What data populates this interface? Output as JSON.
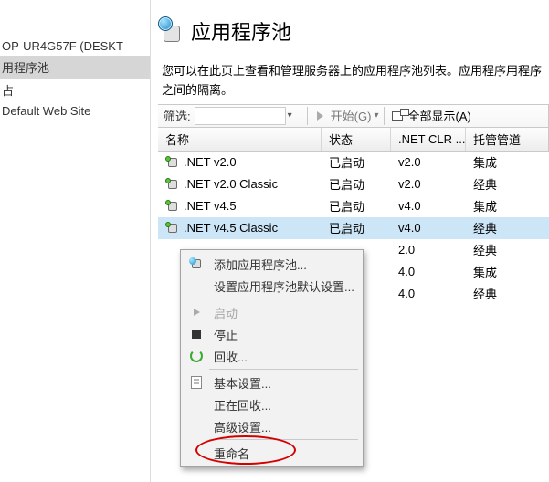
{
  "tree": {
    "items": [
      {
        "label": "OP-UR4G57F (DESKT",
        "selected": false
      },
      {
        "label": "用程序池",
        "selected": true
      },
      {
        "label": "占",
        "selected": false
      },
      {
        "label": "Default Web Site",
        "selected": false
      }
    ]
  },
  "header": {
    "title": "应用程序池",
    "description": "您可以在此页上查看和管理服务器上的应用程序池列表。应用程序用程序之间的隔离。"
  },
  "toolbar": {
    "filter_label": "筛选:",
    "filter_value": "",
    "start_label": "开始(G)",
    "showall_label": "全部显示(A)"
  },
  "columns": {
    "name": "名称",
    "status": "状态",
    "net": ".NET CLR ...",
    "pipeline": "托管管道"
  },
  "rows": [
    {
      "name": ".NET v2.0",
      "status": "已启动",
      "net": "v2.0",
      "pipeline": "集成",
      "selected": false
    },
    {
      "name": ".NET v2.0 Classic",
      "status": "已启动",
      "net": "v2.0",
      "pipeline": "经典",
      "selected": false
    },
    {
      "name": ".NET v4.5",
      "status": "已启动",
      "net": "v4.0",
      "pipeline": "集成",
      "selected": false
    },
    {
      "name": ".NET v4.5 Classic",
      "status": "已启动",
      "net": "v4.0",
      "pipeline": "经典",
      "selected": true
    },
    {
      "name": "",
      "status": "",
      "net": "2.0",
      "pipeline": "经典",
      "selected": false
    },
    {
      "name": "",
      "status": "",
      "net": "4.0",
      "pipeline": "集成",
      "selected": false
    },
    {
      "name": "",
      "status": "",
      "net": "4.0",
      "pipeline": "经典",
      "selected": false
    }
  ],
  "context_menu": {
    "items": [
      {
        "label": "添加应用程序池...",
        "icon": "add",
        "enabled": true
      },
      {
        "label": "设置应用程序池默认设置...",
        "icon": "none",
        "enabled": true
      },
      {
        "sep": true
      },
      {
        "label": "启动",
        "icon": "play",
        "enabled": false
      },
      {
        "label": "停止",
        "icon": "stop",
        "enabled": true
      },
      {
        "label": "回收...",
        "icon": "refresh",
        "enabled": true
      },
      {
        "sep": true
      },
      {
        "label": "基本设置...",
        "icon": "basic",
        "enabled": true
      },
      {
        "label": "正在回收...",
        "icon": "none",
        "enabled": true
      },
      {
        "label": "高级设置...",
        "icon": "none",
        "enabled": true
      },
      {
        "sep": true
      },
      {
        "label": "重命名",
        "icon": "none",
        "enabled": true
      }
    ]
  }
}
